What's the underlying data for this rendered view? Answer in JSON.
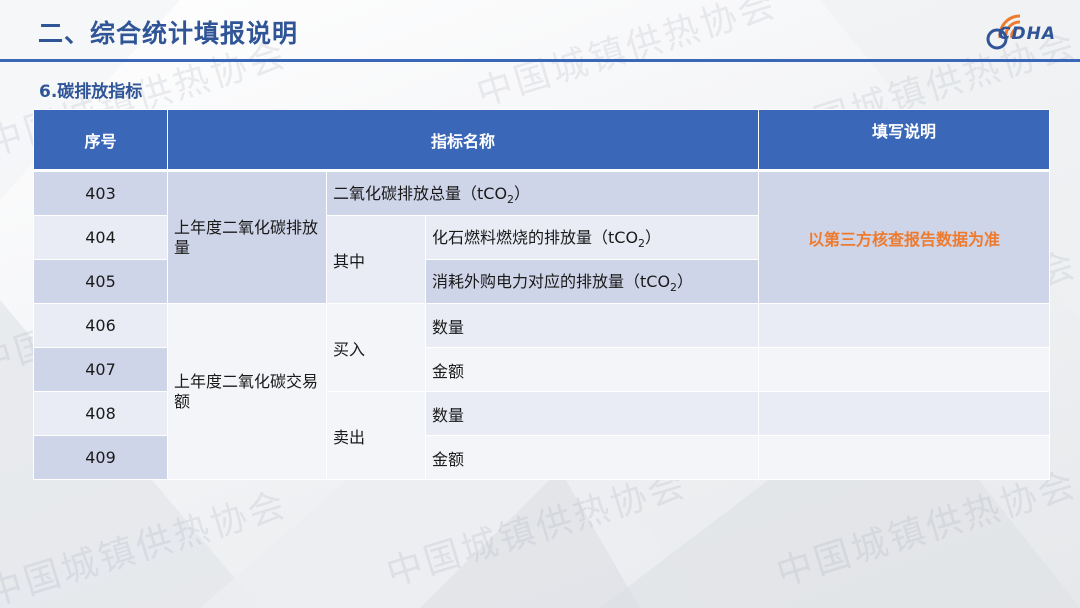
{
  "header": {
    "title": "二、综合统计填报说明",
    "logo_text": "CDHA",
    "rule_color": "#3a67b8"
  },
  "section": {
    "title": "6.碳排放指标"
  },
  "table": {
    "headers": {
      "no": "序号",
      "name": "指标名称",
      "desc": "填写说明"
    },
    "rows_no": [
      "403",
      "404",
      "405",
      "406",
      "407",
      "408",
      "409"
    ],
    "group1": {
      "category": "上年度二氧化碳排放量",
      "total_label": "二氧化碳排放总量（tCO",
      "sub_label": "其中",
      "fossil_label": "化石燃料燃烧的排放量（tCO",
      "power_label": "消耗外购电力对应的排放量（tCO",
      "unit_tail": "）",
      "subscript": "2",
      "note": "以第三方核查报告数据为准"
    },
    "group2": {
      "category": "上年度二氧化碳交易额",
      "buy_label": "买入",
      "sell_label": "卖出",
      "qty_label": "数量",
      "amt_label": "金额"
    }
  },
  "watermark": {
    "text": "中国城镇供热协会"
  },
  "colors": {
    "accent": "#2f5597",
    "header_fill": "#3a67b8",
    "note": "#ee7a2e"
  }
}
